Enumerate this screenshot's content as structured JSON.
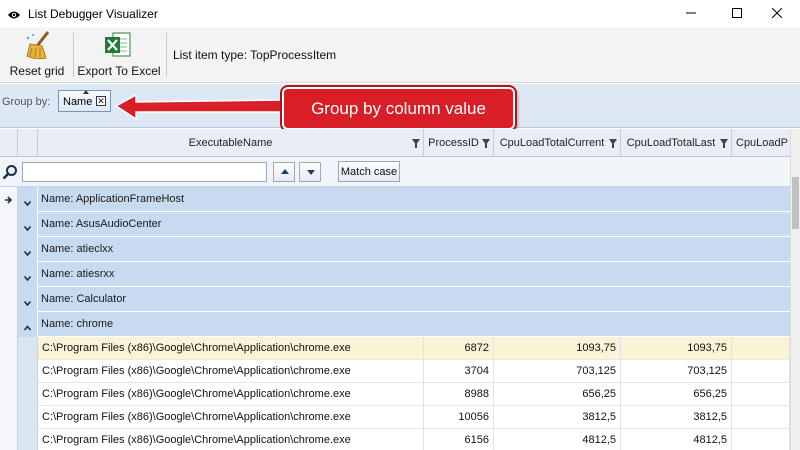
{
  "window": {
    "title": "List Debugger Visualizer"
  },
  "toolbar": {
    "reset_label": "Reset grid",
    "export_label": "Export To Excel",
    "list_item_type": "List item type: TopProcessItem"
  },
  "groupby": {
    "label": "Group by:",
    "chip_label": "Name",
    "chip_close": "✕"
  },
  "callout": {
    "text": "Group by column value"
  },
  "columns": [
    "ExecutableName",
    "ProcessID",
    "CpuLoadTotalCurrent",
    "CpuLoadTotalLast",
    "CpuLoadP"
  ],
  "search": {
    "value": "",
    "placeholder": "",
    "match_case_label": "Match case"
  },
  "groups": [
    "Name: ApplicationFrameHost",
    "Name: AsusAudioCenter",
    "Name: atieclxx",
    "Name: atiesrxx",
    "Name: Calculator",
    "Name: chrome"
  ],
  "rows": [
    [
      "C:\\Program Files (x86)\\Google\\Chrome\\Application\\chrome.exe",
      "6872",
      "1093,75",
      "1093,75",
      ""
    ],
    [
      "C:\\Program Files (x86)\\Google\\Chrome\\Application\\chrome.exe",
      "3704",
      "703,125",
      "703,125",
      ""
    ],
    [
      "C:\\Program Files (x86)\\Google\\Chrome\\Application\\chrome.exe",
      "8988",
      "656,25",
      "656,25",
      ""
    ],
    [
      "C:\\Program Files (x86)\\Google\\Chrome\\Application\\chrome.exe",
      "10056",
      "3812,5",
      "3812,5",
      ""
    ],
    [
      "C:\\Program Files (x86)\\Google\\Chrome\\Application\\chrome.exe",
      "6156",
      "4812,5",
      "4812,5",
      ""
    ]
  ],
  "colors": {
    "accent_red": "#d81e26",
    "group_row": "#c8daef",
    "selected_row": "#fbf3d6"
  }
}
